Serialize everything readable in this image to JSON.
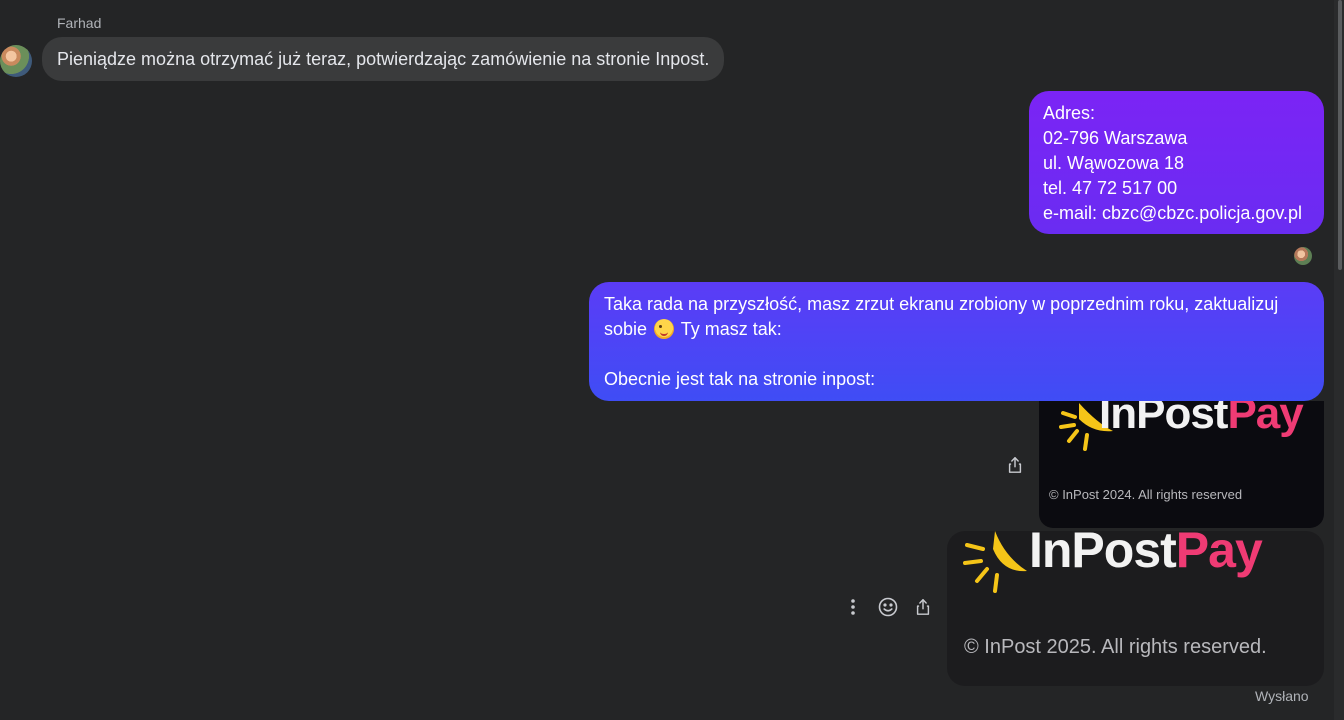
{
  "conversation": {
    "sender_name": "Farhad",
    "incoming_message": "Pieniądze można otrzymać już teraz, potwierdzając zamówienie na stronie Inpost.",
    "address_message": {
      "lines": [
        "Adres:",
        "02-796 Warszawa",
        "ul. Wąwozowa 18",
        "tel. 47 72 517 00",
        "e-mail: cbzc@cbzc.policja.gov.pl"
      ]
    },
    "advice_message": {
      "line1": "Taka rada na przyszłość, masz zrzut ekranu zrobiony w poprzednim roku, zaktualizuj",
      "line2_before_emoji": "sobie",
      "emoji": "winking-face-with-tongue",
      "line2_after_emoji": "Ty masz tak:",
      "line3": "Obecnie jest tak na stronie inpost:"
    },
    "image_old": {
      "logo_in": "InPost",
      "logo_pay": "Pay",
      "copyright": "© InPost 2024. All rights reserved"
    },
    "image_new": {
      "logo_in": "InPost",
      "logo_pay": "Pay",
      "copyright": "© InPost 2025. All rights reserved."
    },
    "status": "Wysłano"
  },
  "icons": {
    "share": "share-icon",
    "more": "more-vertical-icon",
    "react": "smiley-icon"
  },
  "colors": {
    "background": "#242526",
    "incoming_bubble": "#3a3b3c",
    "outgoing_purple": "#7b24f5",
    "outgoing_blue": "#3f4df5",
    "inpost_pay_pink": "#ef3b74",
    "inpost_sun_yellow": "#f5c518"
  }
}
